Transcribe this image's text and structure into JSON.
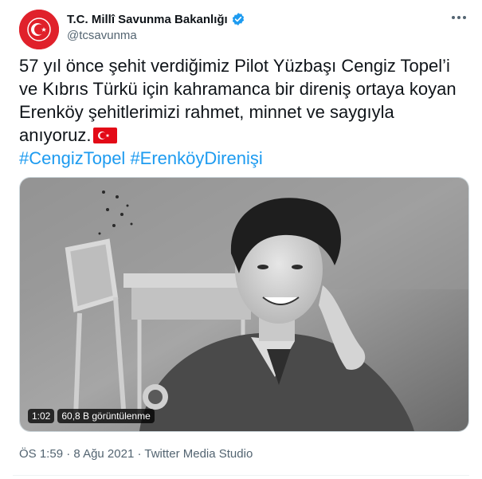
{
  "author": {
    "name": "T.C. Millî Savunma Bakanlığı",
    "handle": "@tcsavunma",
    "verified_icon": "verified-badge-icon",
    "avatar_icon": "crescent-star-emblem-icon",
    "avatar_color": "#e0212b"
  },
  "tweet": {
    "text_lines": [
      "57 yıl önce şehit verdiğimiz Pilot Yüzbaşı Cengiz Topel’i",
      "ve Kıbrıs Türkü için kahramanca bir direniş ortaya koyan",
      "Erenköy şehitlerimizi rahmet, minnet ve saygıyla",
      "anıyoruz."
    ],
    "flag_icon": "turkey-flag-emoji-icon",
    "hashtags": [
      "#CengizTopel",
      "#ErenköyDirenişi"
    ],
    "hashtag_color": "#1d9bf0"
  },
  "media": {
    "duration": "1:02",
    "views": "60,8 B görüntülenme"
  },
  "meta": {
    "time": "ÖS 1:59",
    "separator1": "·",
    "date": "8 Ağu 2021",
    "separator2": "·",
    "source": "Twitter Media Studio"
  },
  "menu_icon": "more-options-icon"
}
